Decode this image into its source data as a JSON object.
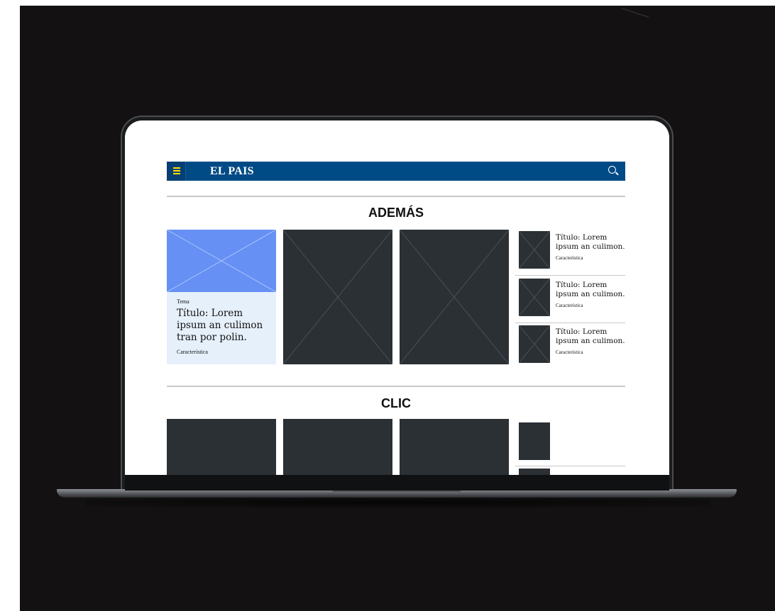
{
  "site": {
    "logo_text": "EL PAIS",
    "brand_color": "#004a85",
    "menu_icon_color": "#ffe000"
  },
  "sections": [
    {
      "title": "ADEMÁS",
      "featured": {
        "tag": "Tema",
        "title": "Título: Lorem ipsum an culimon tran por polin.",
        "meta": "Característica",
        "image_color": "#6690f4"
      },
      "side_items": [
        {
          "title": "Título: Lorem ipsum an culimon.",
          "meta": "Característica"
        },
        {
          "title": "Título: Lorem ipsum an culimon.",
          "meta": "Característica"
        },
        {
          "title": "Título: Lorem ipsum an culimon.",
          "meta": "Característica"
        }
      ]
    },
    {
      "title": "CLIC"
    }
  ],
  "icons": {
    "menu": "hamburger-icon",
    "search": "search-icon",
    "placeholder": "image-placeholder-icon"
  }
}
